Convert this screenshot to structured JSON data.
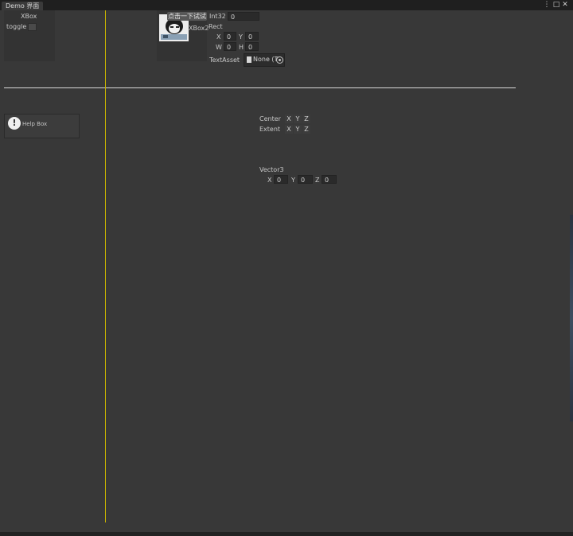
{
  "window": {
    "tab_title": "Demo 界面",
    "more_icon": "⋮",
    "maximize_icon": "□",
    "close_icon": "✕"
  },
  "left_panel": {
    "xbox_label": "XBox",
    "toggle_label": "toggle"
  },
  "mid_panel": {
    "button_label": "点击一下试试",
    "xbox2_label": "XBox2"
  },
  "fields": {
    "int32_label": "Int32",
    "int32_value": "0",
    "rect_label": "Rect",
    "rect_x_label": "X",
    "rect_x_value": "0",
    "rect_y_label": "Y",
    "rect_y_value": "0",
    "rect_w_label": "W",
    "rect_w_value": "0",
    "rect_h_label": "H",
    "rect_h_value": "0",
    "textasset_label": "TextAsset",
    "textasset_value": "None (T"
  },
  "help_box": {
    "text": "Help Box",
    "icon": "!"
  },
  "bounds": {
    "center_label": "Center",
    "extent_label": "Extent",
    "axis_x": "X",
    "axis_y": "Y",
    "axis_z": "Z"
  },
  "vector3": {
    "label": "Vector3",
    "x_label": "X",
    "x_value": "0",
    "y_label": "Y",
    "y_value": "0",
    "z_label": "Z",
    "z_value": "0"
  }
}
